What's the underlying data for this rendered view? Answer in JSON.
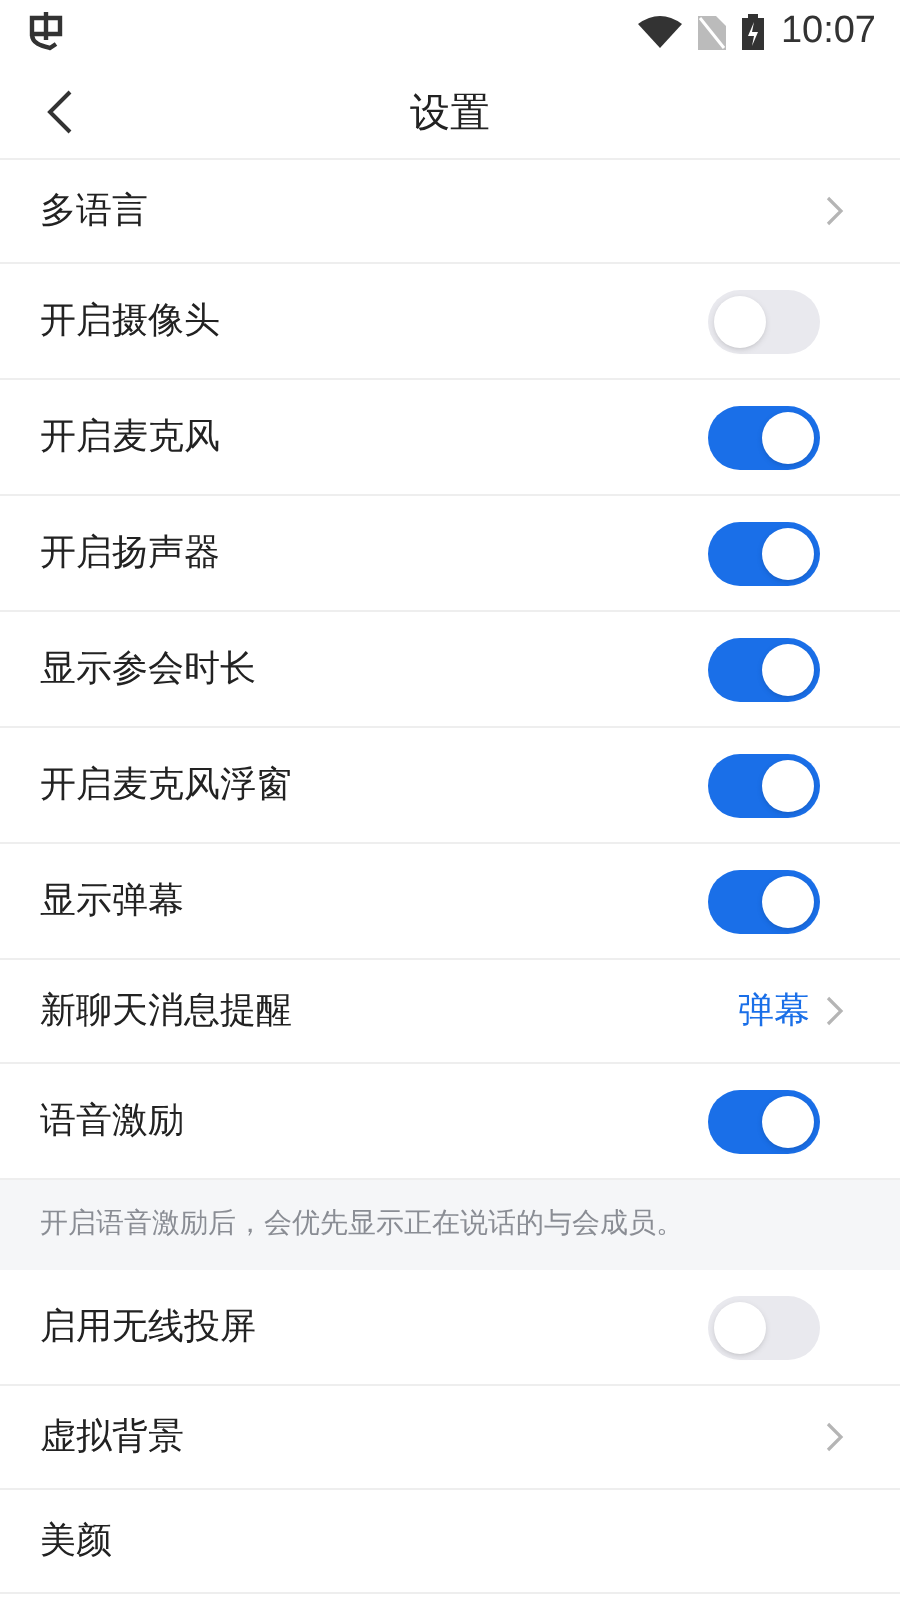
{
  "status_bar": {
    "time": "10:07"
  },
  "header": {
    "title": "设置"
  },
  "items": [
    {
      "kind": "link",
      "label": "多语言"
    },
    {
      "kind": "toggle",
      "label": "开启摄像头",
      "on": false
    },
    {
      "kind": "toggle",
      "label": "开启麦克风",
      "on": true
    },
    {
      "kind": "toggle",
      "label": "开启扬声器",
      "on": true
    },
    {
      "kind": "toggle",
      "label": "显示参会时长",
      "on": true
    },
    {
      "kind": "toggle",
      "label": "开启麦克风浮窗",
      "on": true
    },
    {
      "kind": "toggle",
      "label": "显示弹幕",
      "on": true
    },
    {
      "kind": "link",
      "label": "新聊天消息提醒",
      "value": "弹幕"
    },
    {
      "kind": "toggle",
      "label": "语音激励",
      "on": true
    },
    {
      "kind": "note",
      "label": "开启语音激励后，会优先显示正在说话的与会成员。"
    },
    {
      "kind": "toggle",
      "label": "启用无线投屏",
      "on": false
    },
    {
      "kind": "link",
      "label": "虚拟背景"
    },
    {
      "kind": "plain",
      "label": "美颜"
    }
  ]
}
